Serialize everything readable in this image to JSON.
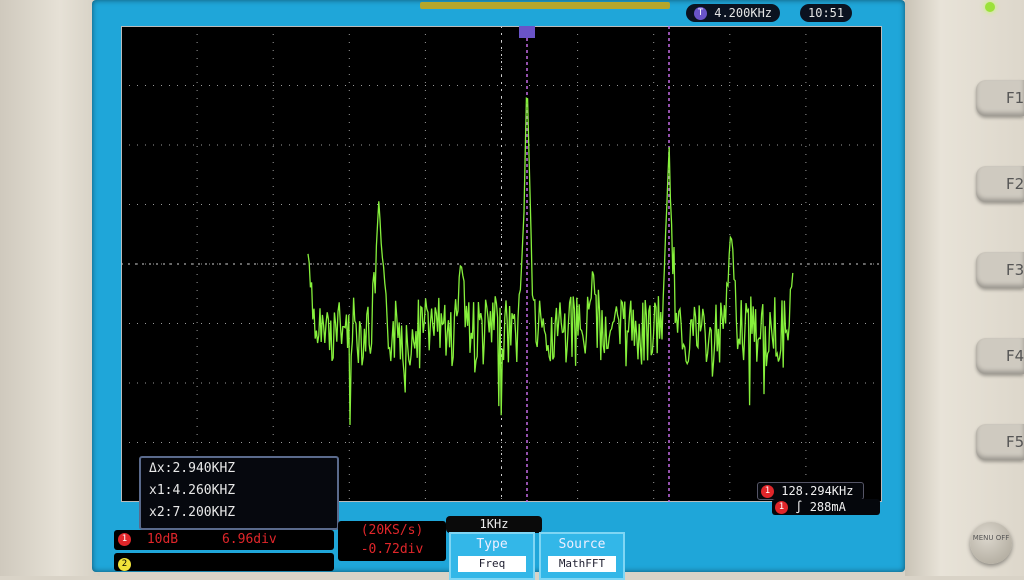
{
  "status_bar": {
    "trigger_freq": "4.200KHz",
    "time": "10:51",
    "trigger_channel": "T"
  },
  "cursors": {
    "delta_x": "Δx:2.940KHZ",
    "x1": "x1:4.260KHZ",
    "x2": "x2:7.200KHZ"
  },
  "channel1": {
    "badge": "1",
    "scale": "10dB",
    "position": "6.96div"
  },
  "channel2": {
    "badge": "2"
  },
  "acquisition": {
    "sample_rate": "(20KS/s)",
    "offset": "-0.72div"
  },
  "fft_span": "1KHz",
  "softkeys": [
    {
      "title": "Type",
      "value": "Freq"
    },
    {
      "title": "Source",
      "value": "MathFFT"
    }
  ],
  "marker": {
    "badge": "1",
    "frequency": "128.294KHz"
  },
  "trigger": {
    "badge": "1",
    "level": "288mA",
    "edge_symbol": "∫"
  },
  "function_keys": [
    "F1",
    "F2",
    "F3",
    "F4",
    "F5"
  ],
  "menu_off_label": "MENU OFF",
  "colors": {
    "trace": "#86f03c",
    "cursor": "#c46be6",
    "screen": "#1fa6d9",
    "channel1": "#e0262a",
    "channel2": "#f0e33a"
  }
}
